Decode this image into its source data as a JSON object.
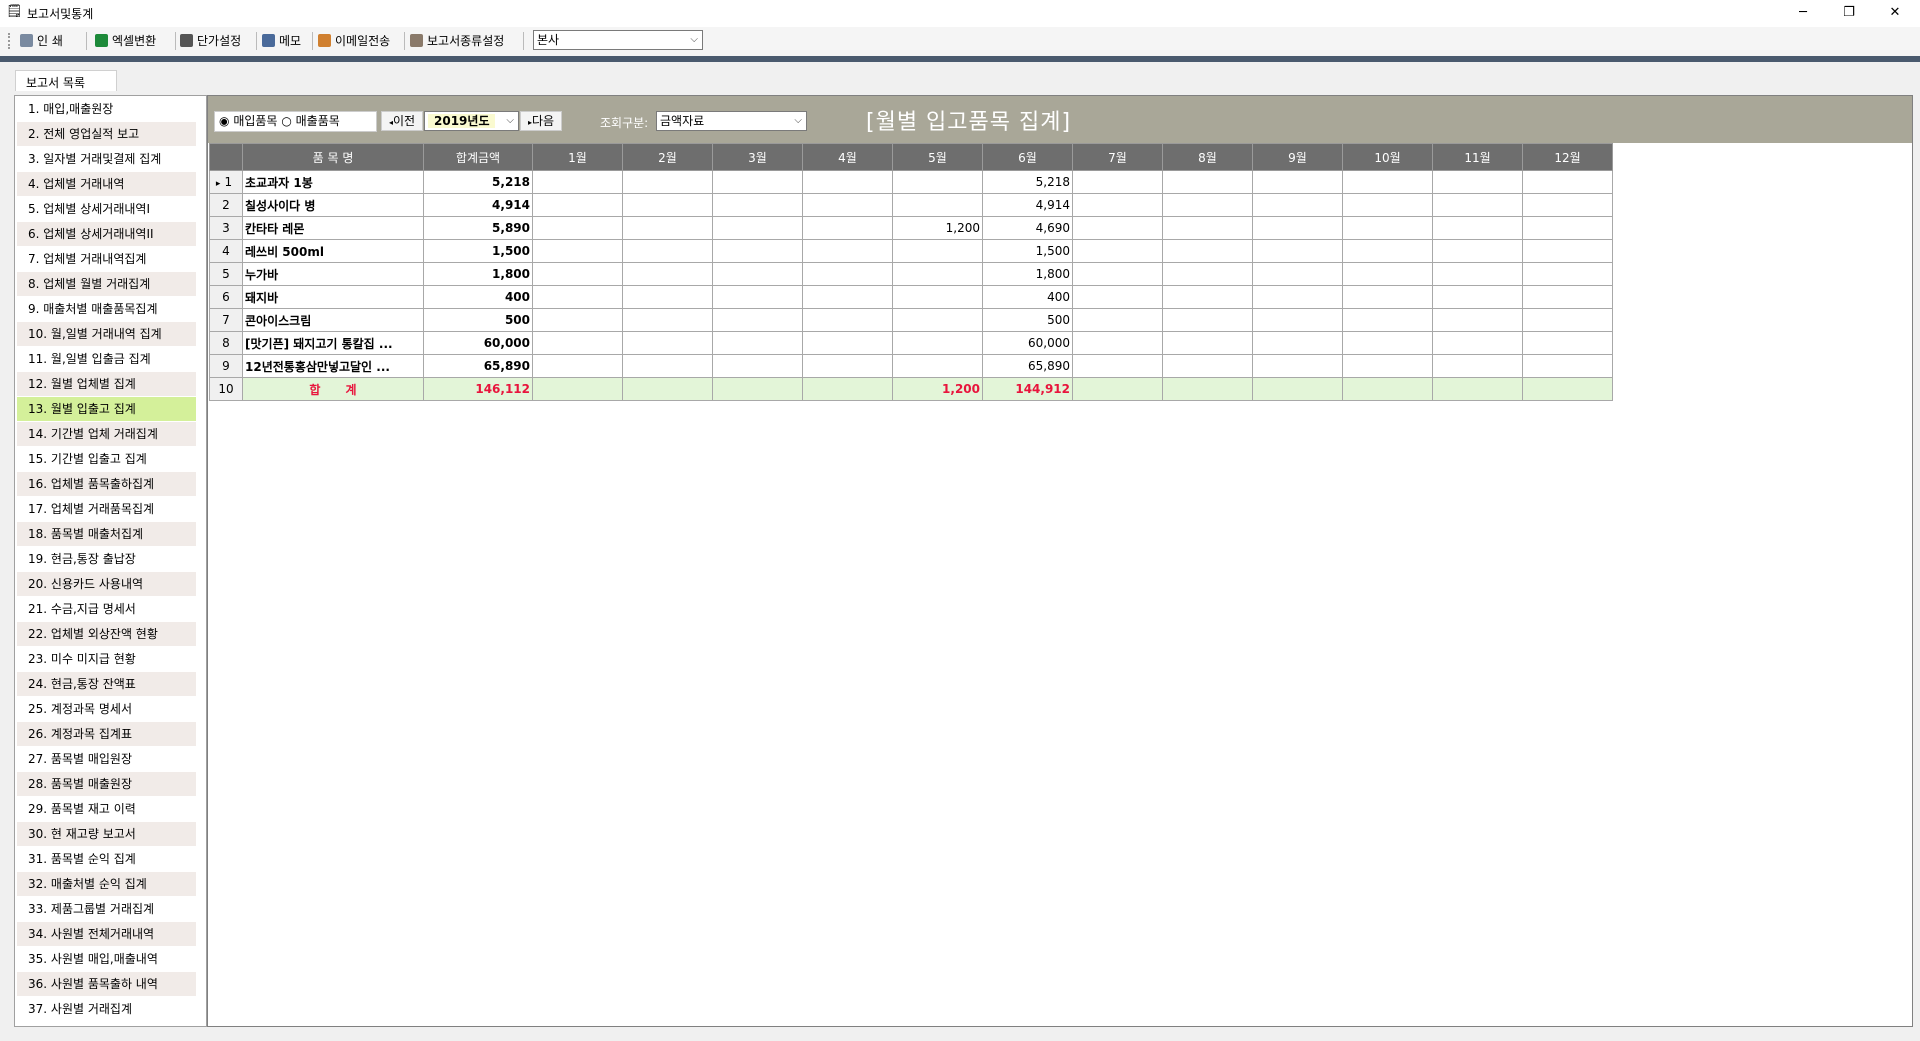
{
  "window": {
    "title": "보고서및통계",
    "minimize": "─",
    "restore": "❐",
    "close": "✕"
  },
  "toolbar": {
    "items": [
      {
        "label": "인 쇄",
        "icon": "printer-icon",
        "color": "#7a8aa0"
      },
      {
        "label": "엑셀변환",
        "icon": "excel-icon",
        "color": "#1d8a3a"
      },
      {
        "label": "단가설정",
        "icon": "price-icon",
        "color": "#555555"
      },
      {
        "label": "메모",
        "icon": "memo-icon",
        "color": "#4a6a9a"
      },
      {
        "label": "이메일전송",
        "icon": "email-icon",
        "color": "#d08030"
      },
      {
        "label": "보고서종류설정",
        "icon": "settings-icon",
        "color": "#8a7a6a"
      }
    ],
    "branch_select": "본사"
  },
  "sidebar": {
    "tab_label": "보고서 목록",
    "selected_index": 12,
    "items": [
      "1. 매입,매출원장",
      "2. 전체 영업실적 보고",
      "3. 일자별 거래및결제 집계",
      "4. 업체별 거래내역",
      "5. 업체별 상세거래내역I",
      "6. 업체별 상세거래내역II",
      "7. 업체별 거래내역집계",
      "8. 업체별 월별 거래집계",
      "9. 매출처별 매출품목집계",
      "10. 월,일별 거래내역 집계",
      "11. 월,일별 입출금 집계",
      "12. 월별 업체별 집계",
      "13. 월별 입출고 집계",
      "14. 기간별 업체 거래집계",
      "15. 기간별 입출고 집계",
      "16. 업체별 품목출하집계",
      "17. 업체별 거래품목집계",
      "18. 품목별 매출처집계",
      "19. 현금,통장 출납장",
      "20. 신용카드 사용내역",
      "21. 수금,지급 명세서",
      "22. 업체별 외상잔액 현황",
      "23. 미수 미지급 현황",
      "24. 현금,통장 잔액표",
      "25. 계정과목 명세서",
      "26. 계정과목 집계표",
      "27. 품목별 매입원장",
      "28. 품목별 매출원장",
      "29. 품목별 재고 이력",
      "30. 현 재고량 보고서",
      "31. 품목별 순익 집계",
      "32. 매출처별 순익 집계",
      "33. 제품그룹별 거래집계",
      "34. 사원별 전체거래내역",
      "35. 사원별 매입,매출내역",
      "36. 사원별 품목출하 내역",
      "37. 사원별 거래집계"
    ]
  },
  "filters": {
    "radio_purchase": "매입품목",
    "radio_sales": "매출품목",
    "selected": "매입품목",
    "prev": "이전",
    "year": "2019년도",
    "next": "다음",
    "query_label": "조회구분:",
    "query_value": "금액자료"
  },
  "report_title": "[월별 입고품목 집계]",
  "grid": {
    "columns": [
      "",
      "품 목 명",
      "합계금액",
      "1월",
      "2월",
      "3월",
      "4월",
      "5월",
      "6월",
      "7월",
      "8월",
      "9월",
      "10월",
      "11월",
      "12월"
    ],
    "rows": [
      {
        "no": "1",
        "name": "초교과자 1봉",
        "total": "5,218",
        "months": [
          "",
          "",
          "",
          "",
          "",
          "5,218",
          "",
          "",
          "",
          "",
          "",
          ""
        ]
      },
      {
        "no": "2",
        "name": "칠성사이다 병",
        "total": "4,914",
        "months": [
          "",
          "",
          "",
          "",
          "",
          "4,914",
          "",
          "",
          "",
          "",
          "",
          ""
        ]
      },
      {
        "no": "3",
        "name": "칸타타 레몬",
        "total": "5,890",
        "months": [
          "",
          "",
          "",
          "",
          "1,200",
          "4,690",
          "",
          "",
          "",
          "",
          "",
          ""
        ]
      },
      {
        "no": "4",
        "name": "레쓰비 500ml",
        "total": "1,500",
        "months": [
          "",
          "",
          "",
          "",
          "",
          "1,500",
          "",
          "",
          "",
          "",
          "",
          ""
        ]
      },
      {
        "no": "5",
        "name": "누가바",
        "total": "1,800",
        "months": [
          "",
          "",
          "",
          "",
          "",
          "1,800",
          "",
          "",
          "",
          "",
          "",
          ""
        ]
      },
      {
        "no": "6",
        "name": "돼지바",
        "total": "400",
        "months": [
          "",
          "",
          "",
          "",
          "",
          "400",
          "",
          "",
          "",
          "",
          "",
          ""
        ]
      },
      {
        "no": "7",
        "name": "콘아이스크림",
        "total": "500",
        "months": [
          "",
          "",
          "",
          "",
          "",
          "500",
          "",
          "",
          "",
          "",
          "",
          ""
        ]
      },
      {
        "no": "8",
        "name": "[맛기픈] 돼지고기 통칼집 ...",
        "total": "60,000",
        "months": [
          "",
          "",
          "",
          "",
          "",
          "60,000",
          "",
          "",
          "",
          "",
          "",
          ""
        ]
      },
      {
        "no": "9",
        "name": "12년전통홍삼만넣고달인 ...",
        "total": "65,890",
        "months": [
          "",
          "",
          "",
          "",
          "",
          "65,890",
          "",
          "",
          "",
          "",
          "",
          ""
        ]
      }
    ],
    "total_row": {
      "no": "10",
      "name": "합      계",
      "total": "146,112",
      "months": [
        "",
        "",
        "",
        "",
        "1,200",
        "144,912",
        "",
        "",
        "",
        "",
        "",
        ""
      ]
    }
  }
}
